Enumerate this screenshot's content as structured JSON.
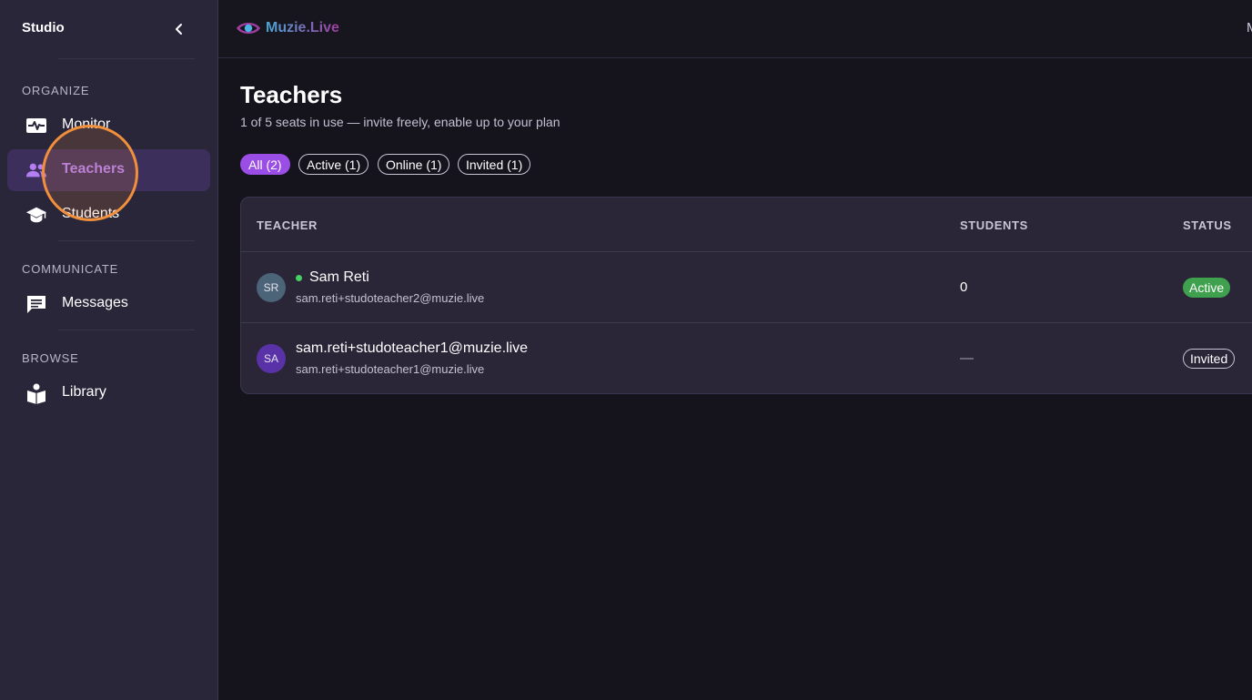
{
  "sidebar": {
    "title": "Studio",
    "sections": [
      {
        "label": "ORGANIZE",
        "items": [
          {
            "label": "Monitor",
            "icon": "monitor-heart-icon"
          },
          {
            "label": "Teachers",
            "icon": "people-icon",
            "active": true
          },
          {
            "label": "Students",
            "icon": "graduation-cap-icon"
          }
        ]
      },
      {
        "label": "COMMUNICATE",
        "items": [
          {
            "label": "Messages",
            "icon": "chat-icon"
          }
        ]
      },
      {
        "label": "BROWSE",
        "items": [
          {
            "label": "Library",
            "icon": "book-reader-icon"
          }
        ]
      }
    ]
  },
  "topbar": {
    "logo_text": "Muzie.Live",
    "right_cut_text": "M"
  },
  "page": {
    "title": "Teachers",
    "subtitle": "1 of 5 seats in use — invite freely, enable up to your plan"
  },
  "filters": [
    {
      "label": "All (2)",
      "selected": true
    },
    {
      "label": "Active (1)",
      "selected": false
    },
    {
      "label": "Online (1)",
      "selected": false
    },
    {
      "label": "Invited (1)",
      "selected": false
    }
  ],
  "table": {
    "columns": [
      "TEACHER",
      "STUDENTS",
      "STATUS"
    ],
    "rows": [
      {
        "initials": "SR",
        "name": "Sam Reti",
        "online": true,
        "email": "sam.reti+studoteacher2@muzie.live",
        "students": "0",
        "status": "Active"
      },
      {
        "initials": "SA",
        "name": "sam.reti+studoteacher1@muzie.live",
        "online": false,
        "email": "sam.reti+studoteacher1@muzie.live",
        "students": "—",
        "status": "Invited"
      }
    ]
  },
  "colors": {
    "accent": "#9b4ee6",
    "active_badge": "#3fa14e",
    "online_dot": "#45d061",
    "highlight": "#f0903c"
  }
}
